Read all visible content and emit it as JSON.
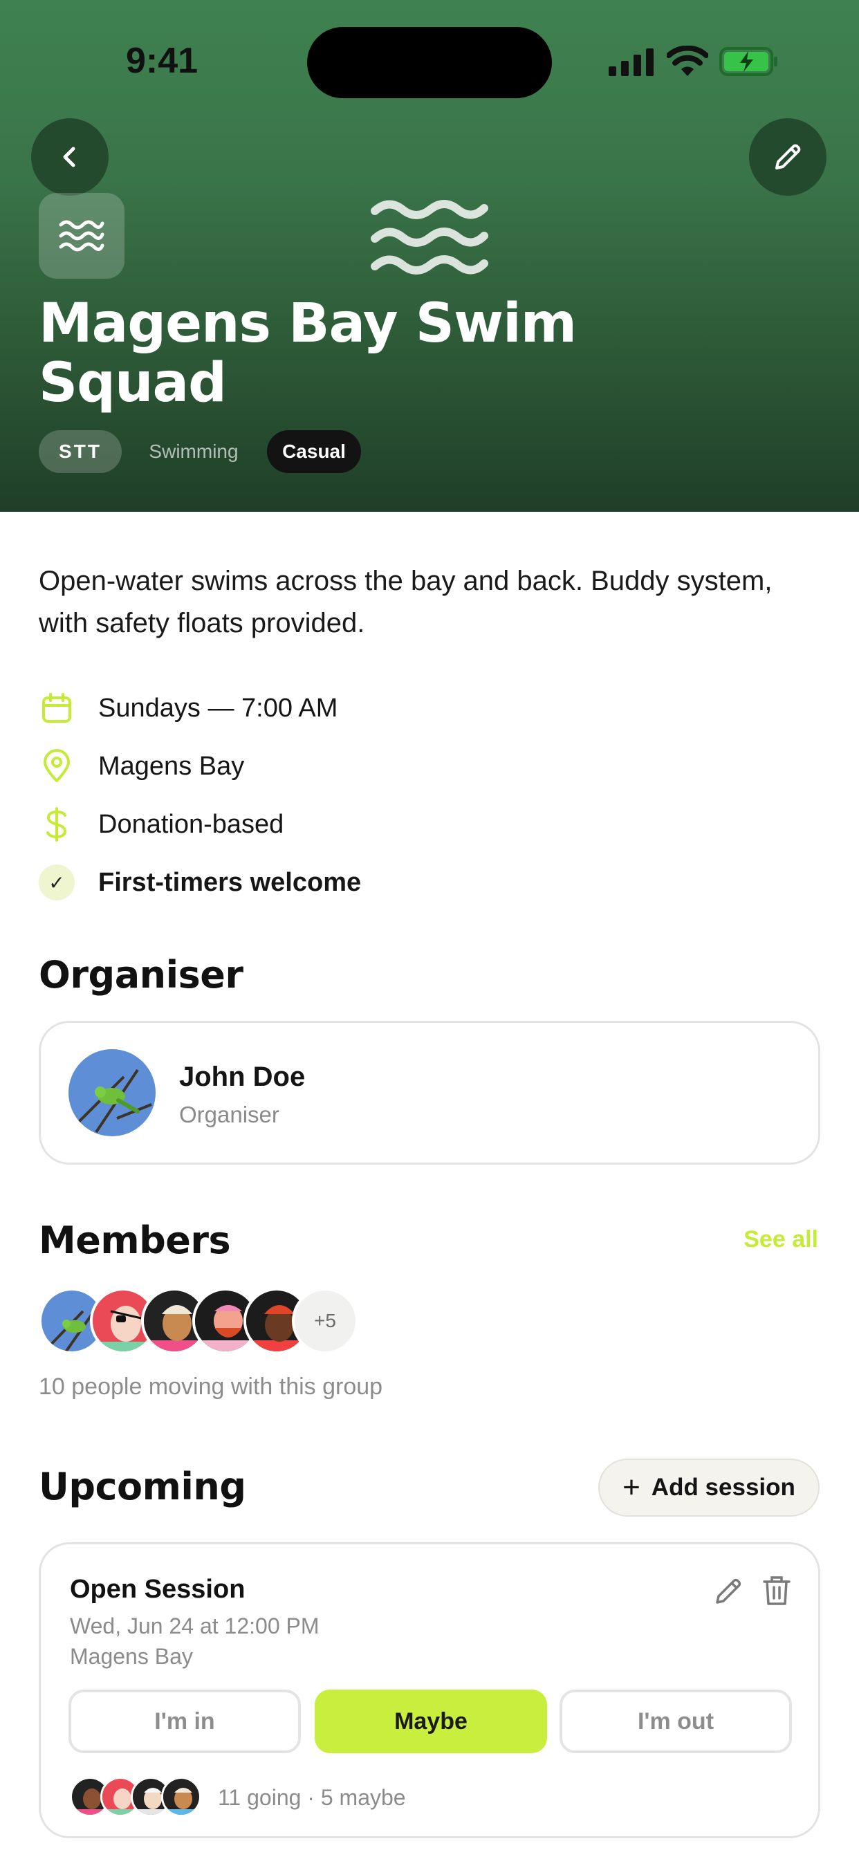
{
  "status_bar": {
    "time": "9:41"
  },
  "group": {
    "title": "Magens Bay Swim Squad",
    "chips": {
      "location": "STT",
      "sport": "Swimming",
      "level": "Casual"
    },
    "description": "Open-water swims across the bay and back. Buddy system, with safety floats provided.",
    "details": {
      "schedule": "Sundays — 7:00 AM",
      "location": "Magens Bay",
      "price": "Donation-based",
      "newcomers": "First-timers welcome"
    }
  },
  "organiser_section": {
    "heading": "Organiser",
    "name": "John Doe",
    "role": "Organiser"
  },
  "members_section": {
    "heading": "Members",
    "see_all": "See all",
    "more_count": "+5",
    "caption": "10 people moving with this group"
  },
  "upcoming_section": {
    "heading": "Upcoming",
    "add_label": "Add session",
    "session": {
      "title": "Open Session",
      "when": "Wed, Jun 24 at 12:00 PM",
      "where": "Magens Bay",
      "rsvp": {
        "in": "I'm in",
        "maybe": "Maybe",
        "out": "I'm out",
        "selected": "Maybe"
      },
      "attendance": "11 going · 5 maybe"
    }
  },
  "colors": {
    "accent": "#c8ef3d",
    "hero_top": "#3f8250",
    "hero_bottom": "#1f3f28"
  }
}
